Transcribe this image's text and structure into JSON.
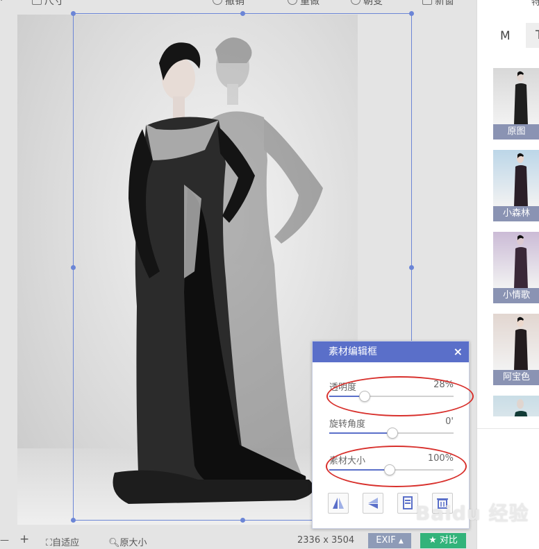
{
  "toolbar": {
    "items": [
      {
        "label": "尺寸",
        "icon": "crop-icon"
      },
      {
        "label": "撤销",
        "icon": "undo-icon"
      },
      {
        "label": "重做",
        "icon": "redo-icon"
      },
      {
        "label": "朝变",
        "icon": "rotate-icon"
      },
      {
        "label": "新窗",
        "icon": "window-icon"
      }
    ]
  },
  "editor": {
    "title": "素材编辑框",
    "close": "×",
    "controls": [
      {
        "label": "透明度",
        "value": "28%",
        "fraction": 0.28
      },
      {
        "label": "旋转角度",
        "value": "0'",
        "fraction": 0.5
      },
      {
        "label": "素材大小",
        "value": "100%",
        "fraction": 0.48
      }
    ],
    "tools": [
      "flip-horizontal-icon",
      "flip-vertical-icon",
      "layer-icon",
      "delete-icon"
    ]
  },
  "bottom": {
    "minus": "—",
    "plus": "+",
    "fit": "自适应",
    "original": "原大小",
    "dimensions": "2336 x 3504",
    "exif": "EXIF",
    "compare": "对比"
  },
  "right_panel": {
    "header": "特",
    "tab_m": "M",
    "tab_t": "T",
    "filters": [
      {
        "label": "原图",
        "tint": "#d8d8d8"
      },
      {
        "label": "小森林",
        "tint": "#bcd6e8"
      },
      {
        "label": "小情歌",
        "tint": "#cbbbd6"
      },
      {
        "label": "阿宝色",
        "tint": "#e2d6d0"
      },
      {
        "label": "",
        "tint": "#c9dde6"
      }
    ]
  },
  "watermark": "Baidu 经验",
  "colors": {
    "accent": "#5a6fc9",
    "ellipse": "#d8302c",
    "compare": "#32b37a"
  }
}
